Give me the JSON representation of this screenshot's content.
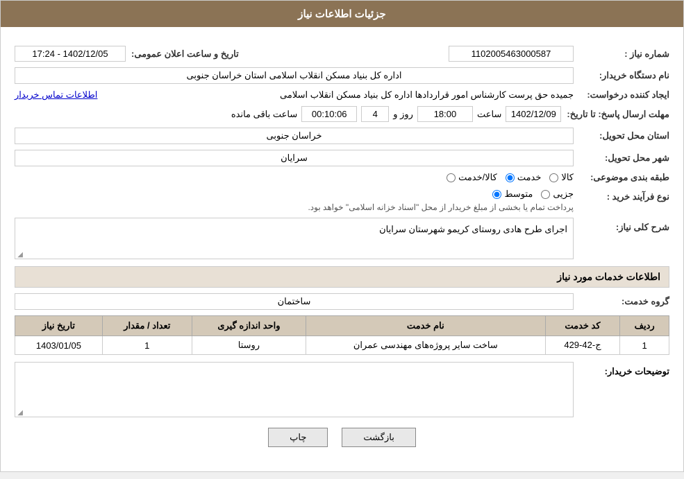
{
  "header": {
    "title": "جزئیات اطلاعات نیاز"
  },
  "fields": {
    "need_number_label": "شماره نیاز :",
    "need_number_value": "1102005463000587",
    "announcement_label": "تاریخ و ساعت اعلان عمومی:",
    "announcement_value": "1402/12/05 - 17:24",
    "buyer_org_label": "نام دستگاه خریدار:",
    "buyer_org_value": "اداره کل بنیاد مسکن انقلاب اسلامی استان خراسان جنوبی",
    "creator_label": "ایجاد کننده درخواست:",
    "creator_value": "جمیده حق پرست کارشناس امور قراردادها اداره کل بنیاد مسکن انقلاب اسلامی",
    "creator_link": "اطلاعات تماس خریدار",
    "deadline_label": "مهلت ارسال پاسخ: تا تاریخ:",
    "deadline_date": "1402/12/09",
    "deadline_time_label": "ساعت",
    "deadline_time": "18:00",
    "deadline_day_label": "روز و",
    "deadline_days": "4",
    "deadline_remaining_label": "ساعت باقی مانده",
    "deadline_remaining": "00:10:06",
    "province_label": "استان محل تحویل:",
    "province_value": "خراسان جنوبی",
    "city_label": "شهر محل تحویل:",
    "city_value": "سرایان",
    "category_label": "طبقه بندی موضوعی:",
    "category_options": [
      "کالا",
      "خدمت",
      "کالا/خدمت"
    ],
    "category_selected": "خدمت",
    "process_label": "نوع فرآیند خرید :",
    "process_options": [
      "جزیی",
      "متوسط"
    ],
    "process_selected": "متوسط",
    "process_note": "پرداخت تمام یا بخشی از مبلغ خریدار از محل \"اسناد خزانه اسلامی\" خواهد بود.",
    "need_desc_label": "شرح کلی نیاز:",
    "need_desc_value": "اجرای طرح هادی روستای کریمو شهرستان سرایان",
    "services_section": "اطلاعات خدمات مورد نیاز",
    "service_group_label": "گروه خدمت:",
    "service_group_value": "ساختمان",
    "table": {
      "headers": [
        "ردیف",
        "کد خدمت",
        "نام خدمت",
        "واحد اندازه گیری",
        "تعداد / مقدار",
        "تاریخ نیاز"
      ],
      "rows": [
        {
          "row": "1",
          "code": "ج-42-429",
          "name": "ساخت سایر پروژه‌های مهندسی عمران",
          "unit": "روستا",
          "quantity": "1",
          "date": "1403/01/05"
        }
      ]
    },
    "buyer_notes_label": "توضیحات خریدار:",
    "buyer_notes_value": ""
  },
  "buttons": {
    "print": "چاپ",
    "back": "بازگشت"
  }
}
